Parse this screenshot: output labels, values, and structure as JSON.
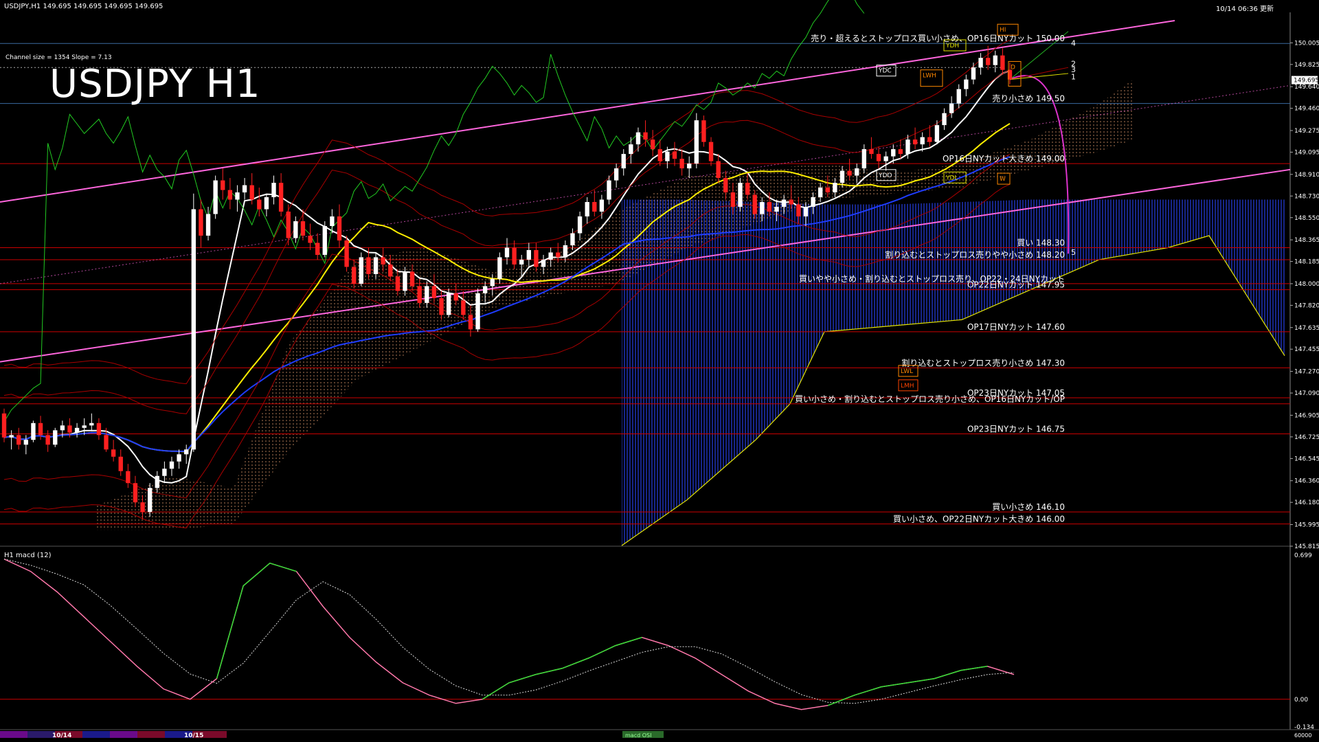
{
  "header": {
    "symbol_line": "USDJPY,H1  149.695 149.695 149.695 149.695",
    "datetime": "10/14 06:36 更新",
    "channel_info": "Channel size = 1354 Slope = 7.13",
    "title": "USDJPY H1"
  },
  "colors": {
    "background": "#000000",
    "bull_candle": "#ffffff",
    "bear_candle": "#ff2020",
    "ma_short": "#ffffff",
    "ma_mid": "#ffee00",
    "ma_long": "#1e3cff",
    "chikou": "#22cc22",
    "channel": "#ff66dd",
    "level_line": "#cc0000",
    "cloud_kumo": "#1a2a99",
    "cloud_dots": "#e8a070",
    "macd_line_up": "#33dd33",
    "macd_line_down": "#ff77aa"
  },
  "chart_data": {
    "type": "candlestick",
    "symbol": "USDJPY",
    "timeframe": "H1",
    "ylim": [
      145.815,
      150.19
    ],
    "last_price": 149.695,
    "ticks": [
      "150.005",
      "149.825",
      "149.640",
      "149.460",
      "149.275",
      "149.095",
      "148.910",
      "148.730",
      "148.550",
      "148.365",
      "148.185",
      "148.000",
      "147.820",
      "147.635",
      "147.455",
      "147.270",
      "147.090",
      "146.905",
      "146.725",
      "146.545",
      "146.360",
      "146.180",
      "145.995",
      "145.815"
    ],
    "levels": [
      {
        "price": 150.0,
        "label": "売り・超えるとストップロス買い小さめ、OP16日NYカット 150.00"
      },
      {
        "price": 149.5,
        "label": "売り小さめ 149.50"
      },
      {
        "price": 149.0,
        "label": "OP16日NYカット大きめ 149.00"
      },
      {
        "price": 148.3,
        "label": "買い 148.30"
      },
      {
        "price": 148.2,
        "label": "割り込むとストップロス売りやや小さめ 148.20"
      },
      {
        "price": 148.0,
        "label": "買いやや小さめ・割り込むとストップロス売り、OP22・24日NYカット"
      },
      {
        "price": 147.95,
        "label": "OP22日NYカット 147.95"
      },
      {
        "price": 147.6,
        "label": "OP17日NYカット 147.60"
      },
      {
        "price": 147.3,
        "label": "割り込むとストップロス売り小さめ 147.30"
      },
      {
        "price": 147.05,
        "label": "OP23日NYカット 147.05"
      },
      {
        "price": 147.0,
        "label": "買い小さめ・割り込むとストップロス売り小さめ、OP16日NYカット/OP"
      },
      {
        "price": 146.75,
        "label": "OP23日NYカット 146.75"
      },
      {
        "price": 146.1,
        "label": "買い小さめ 146.10"
      },
      {
        "price": 146.0,
        "label": "買い小さめ、OP22日NYカット大きめ 146.00"
      }
    ],
    "candles": [
      [
        146.92,
        146.96,
        146.68,
        146.72
      ],
      [
        146.72,
        146.78,
        146.62,
        146.74
      ],
      [
        146.74,
        146.8,
        146.62,
        146.66
      ],
      [
        146.66,
        146.74,
        146.58,
        146.7
      ],
      [
        146.7,
        146.86,
        146.68,
        146.84
      ],
      [
        146.84,
        146.9,
        146.7,
        146.74
      ],
      [
        146.74,
        146.78,
        146.6,
        146.66
      ],
      [
        146.66,
        146.8,
        146.64,
        146.78
      ],
      [
        146.78,
        146.86,
        146.72,
        146.82
      ],
      [
        146.82,
        146.88,
        146.72,
        146.76
      ],
      [
        146.76,
        146.84,
        146.72,
        146.8
      ],
      [
        146.8,
        146.88,
        146.74,
        146.82
      ],
      [
        146.82,
        146.92,
        146.78,
        146.84
      ],
      [
        146.84,
        146.88,
        146.7,
        146.74
      ],
      [
        146.74,
        146.8,
        146.6,
        146.62
      ],
      [
        146.62,
        146.7,
        146.52,
        146.56
      ],
      [
        146.56,
        146.62,
        146.4,
        146.44
      ],
      [
        146.44,
        146.5,
        146.3,
        146.34
      ],
      [
        146.34,
        146.4,
        146.14,
        146.18
      ],
      [
        146.18,
        146.24,
        146.04,
        146.1
      ],
      [
        146.1,
        146.34,
        146.06,
        146.3
      ],
      [
        146.3,
        146.44,
        146.26,
        146.4
      ],
      [
        146.4,
        146.52,
        146.34,
        146.46
      ],
      [
        146.46,
        146.56,
        146.4,
        146.52
      ],
      [
        146.52,
        146.62,
        146.46,
        146.58
      ],
      [
        146.58,
        146.66,
        146.5,
        146.62
      ],
      [
        146.62,
        148.75,
        146.6,
        148.62
      ],
      [
        148.62,
        148.7,
        148.3,
        148.4
      ],
      [
        148.4,
        148.64,
        148.36,
        148.58
      ],
      [
        148.58,
        148.9,
        148.54,
        148.86
      ],
      [
        148.86,
        148.96,
        148.7,
        148.78
      ],
      [
        148.78,
        148.88,
        148.62,
        148.7
      ],
      [
        148.7,
        148.82,
        148.6,
        148.76
      ],
      [
        148.76,
        148.88,
        148.7,
        148.82
      ],
      [
        148.82,
        148.92,
        148.66,
        148.7
      ],
      [
        148.7,
        148.8,
        148.56,
        148.62
      ],
      [
        148.62,
        148.74,
        148.56,
        148.72
      ],
      [
        148.72,
        148.9,
        148.66,
        148.84
      ],
      [
        148.84,
        148.92,
        148.56,
        148.6
      ],
      [
        148.6,
        148.66,
        148.32,
        148.38
      ],
      [
        148.38,
        148.56,
        148.34,
        148.52
      ],
      [
        148.52,
        148.62,
        148.36,
        148.4
      ],
      [
        148.4,
        148.5,
        148.28,
        148.34
      ],
      [
        148.34,
        148.42,
        148.2,
        148.24
      ],
      [
        148.24,
        148.52,
        148.22,
        148.48
      ],
      [
        148.48,
        148.62,
        148.42,
        148.56
      ],
      [
        148.56,
        148.66,
        148.3,
        148.36
      ],
      [
        148.36,
        148.4,
        148.1,
        148.14
      ],
      [
        148.14,
        148.2,
        147.96,
        148.0
      ],
      [
        148.0,
        148.26,
        147.98,
        148.22
      ],
      [
        148.22,
        148.3,
        148.04,
        148.08
      ],
      [
        148.08,
        148.26,
        148.04,
        148.22
      ],
      [
        148.22,
        148.3,
        148.1,
        148.16
      ],
      [
        148.16,
        148.24,
        148.02,
        148.06
      ],
      [
        148.06,
        148.12,
        147.9,
        147.94
      ],
      [
        147.94,
        148.14,
        147.9,
        148.1
      ],
      [
        148.1,
        148.16,
        147.94,
        147.98
      ],
      [
        147.98,
        148.04,
        147.8,
        147.84
      ],
      [
        147.84,
        148.02,
        147.8,
        147.98
      ],
      [
        147.98,
        148.08,
        147.84,
        147.88
      ],
      [
        147.88,
        147.94,
        147.7,
        147.74
      ],
      [
        147.74,
        147.96,
        147.72,
        147.92
      ],
      [
        147.92,
        148.0,
        147.82,
        147.86
      ],
      [
        147.86,
        147.94,
        147.7,
        147.74
      ],
      [
        147.74,
        147.82,
        147.56,
        147.62
      ],
      [
        147.62,
        147.96,
        147.6,
        147.92
      ],
      [
        147.92,
        148.02,
        147.84,
        147.98
      ],
      [
        147.98,
        148.08,
        147.9,
        148.04
      ],
      [
        148.04,
        148.26,
        148.0,
        148.22
      ],
      [
        148.22,
        148.38,
        148.16,
        148.3
      ],
      [
        148.3,
        148.36,
        148.12,
        148.16
      ],
      [
        148.16,
        148.24,
        148.06,
        148.2
      ],
      [
        148.2,
        148.34,
        148.14,
        148.28
      ],
      [
        148.28,
        148.34,
        148.1,
        148.14
      ],
      [
        148.14,
        148.24,
        148.08,
        148.2
      ],
      [
        148.2,
        148.3,
        148.14,
        148.26
      ],
      [
        148.26,
        148.34,
        148.18,
        148.22
      ],
      [
        148.22,
        148.36,
        148.18,
        148.32
      ],
      [
        148.32,
        148.46,
        148.28,
        148.42
      ],
      [
        148.42,
        148.6,
        148.36,
        148.56
      ],
      [
        148.56,
        148.72,
        148.5,
        148.68
      ],
      [
        148.68,
        148.78,
        148.56,
        148.6
      ],
      [
        148.6,
        148.74,
        148.54,
        148.7
      ],
      [
        148.7,
        148.9,
        148.66,
        148.86
      ],
      [
        148.86,
        149.0,
        148.8,
        148.96
      ],
      [
        148.96,
        149.12,
        148.9,
        149.08
      ],
      [
        149.08,
        149.22,
        149.0,
        149.16
      ],
      [
        149.16,
        149.3,
        149.1,
        149.26
      ],
      [
        149.26,
        149.36,
        149.14,
        149.2
      ],
      [
        149.2,
        149.28,
        149.06,
        149.12
      ],
      [
        149.12,
        149.2,
        148.98,
        149.02
      ],
      [
        149.02,
        149.14,
        148.96,
        149.1
      ],
      [
        149.1,
        149.18,
        148.98,
        149.04
      ],
      [
        149.04,
        149.12,
        148.9,
        148.96
      ],
      [
        148.96,
        149.06,
        148.88,
        149.0
      ],
      [
        149.0,
        149.42,
        148.96,
        149.36
      ],
      [
        149.36,
        149.4,
        149.14,
        149.18
      ],
      [
        149.18,
        149.22,
        148.98,
        149.02
      ],
      [
        149.02,
        149.08,
        148.84,
        148.88
      ],
      [
        148.88,
        148.94,
        148.7,
        148.76
      ],
      [
        148.76,
        148.84,
        148.58,
        148.64
      ],
      [
        148.64,
        148.88,
        148.6,
        148.84
      ],
      [
        148.84,
        148.92,
        148.7,
        148.74
      ],
      [
        148.74,
        148.78,
        148.54,
        148.58
      ],
      [
        148.58,
        148.72,
        148.52,
        148.68
      ],
      [
        148.68,
        148.76,
        148.56,
        148.6
      ],
      [
        148.6,
        148.7,
        148.52,
        148.64
      ],
      [
        148.64,
        148.74,
        148.58,
        148.7
      ],
      [
        148.7,
        148.82,
        148.62,
        148.66
      ],
      [
        148.66,
        148.72,
        148.5,
        148.56
      ],
      [
        148.56,
        148.68,
        148.48,
        148.64
      ],
      [
        148.64,
        148.76,
        148.58,
        148.72
      ],
      [
        148.72,
        148.84,
        148.68,
        148.8
      ],
      [
        148.8,
        148.9,
        148.72,
        148.76
      ],
      [
        148.76,
        148.88,
        148.72,
        148.84
      ],
      [
        148.84,
        148.98,
        148.8,
        148.94
      ],
      [
        148.94,
        149.04,
        148.86,
        148.9
      ],
      [
        148.9,
        149.0,
        148.84,
        148.96
      ],
      [
        148.96,
        149.16,
        148.92,
        149.12
      ],
      [
        149.12,
        149.22,
        149.04,
        149.08
      ],
      [
        149.08,
        149.14,
        148.96,
        149.02
      ],
      [
        149.02,
        149.1,
        148.94,
        149.06
      ],
      [
        149.06,
        149.16,
        149.0,
        149.12
      ],
      [
        149.12,
        149.2,
        149.04,
        149.08
      ],
      [
        149.08,
        149.24,
        149.04,
        149.2
      ],
      [
        149.2,
        149.3,
        149.12,
        149.16
      ],
      [
        149.16,
        149.26,
        149.1,
        149.22
      ],
      [
        149.22,
        149.32,
        149.14,
        149.18
      ],
      [
        149.18,
        149.36,
        149.16,
        149.32
      ],
      [
        149.32,
        149.46,
        149.28,
        149.42
      ],
      [
        149.42,
        149.56,
        149.38,
        149.5
      ],
      [
        149.5,
        149.66,
        149.46,
        149.62
      ],
      [
        149.62,
        149.74,
        149.56,
        149.7
      ],
      [
        149.7,
        149.84,
        149.66,
        149.8
      ],
      [
        149.8,
        149.92,
        149.74,
        149.88
      ],
      [
        149.88,
        149.98,
        149.78,
        149.82
      ],
      [
        149.82,
        149.94,
        149.76,
        149.9
      ],
      [
        149.9,
        149.96,
        149.74,
        149.78
      ],
      [
        149.78,
        149.84,
        149.66,
        149.7
      ]
    ],
    "macd": {
      "name": "H1 macd (12)",
      "ylim": [
        -0.134,
        0.699
      ],
      "ticks": [
        "0.699",
        "0.00",
        "-0.134"
      ]
    },
    "time_labels": [
      "10/14",
      "10/15"
    ],
    "wave_labels": [
      "4",
      "2",
      "3",
      "1",
      "5"
    ],
    "box_labels": [
      "YDH",
      "YDC",
      "LWH",
      "YDO",
      "YDL",
      "LWL",
      "LMH",
      "D",
      "W",
      "HI"
    ],
    "macd_footer_label": "macd OSI",
    "volume_label": "60000"
  }
}
